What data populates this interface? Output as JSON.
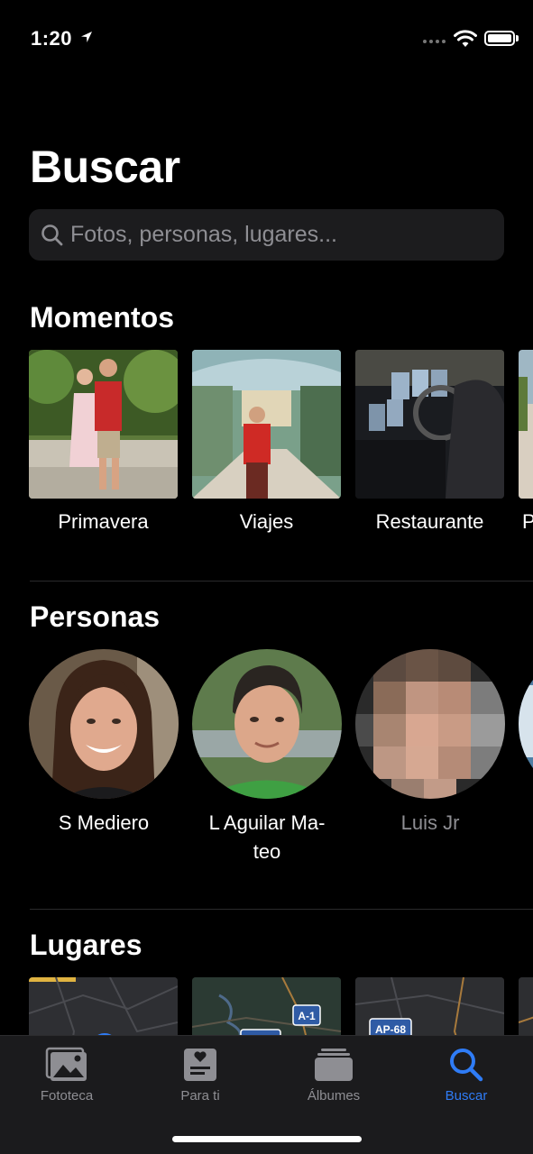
{
  "status_bar": {
    "time": "1:20"
  },
  "header": {
    "title": "Buscar"
  },
  "search": {
    "placeholder": "Fotos, personas, lugares..."
  },
  "moments": {
    "title": "Momentos",
    "items": [
      {
        "label": "Primavera"
      },
      {
        "label": "Viajes"
      },
      {
        "label": "Restaurante"
      },
      {
        "label": "P"
      }
    ]
  },
  "people": {
    "title": "Personas",
    "items": [
      {
        "name": "S Mediero"
      },
      {
        "name": "L Aguilar Ma-\nteo"
      },
      {
        "name": "Luis Jr"
      }
    ]
  },
  "places": {
    "title": "Lugares",
    "road_labels": [
      "A-1",
      "AP-68"
    ]
  },
  "tabs": [
    {
      "label": "Fototeca",
      "icon": "photo-library-icon"
    },
    {
      "label": "Para ti",
      "icon": "for-you-icon"
    },
    {
      "label": "Álbumes",
      "icon": "albums-icon"
    },
    {
      "label": "Buscar",
      "icon": "search-icon",
      "active": true
    }
  ],
  "colors": {
    "accent": "#2f7cf6",
    "background": "#000000",
    "search_field": "#1c1c1e",
    "tab_bar": "#1b1b1d"
  }
}
